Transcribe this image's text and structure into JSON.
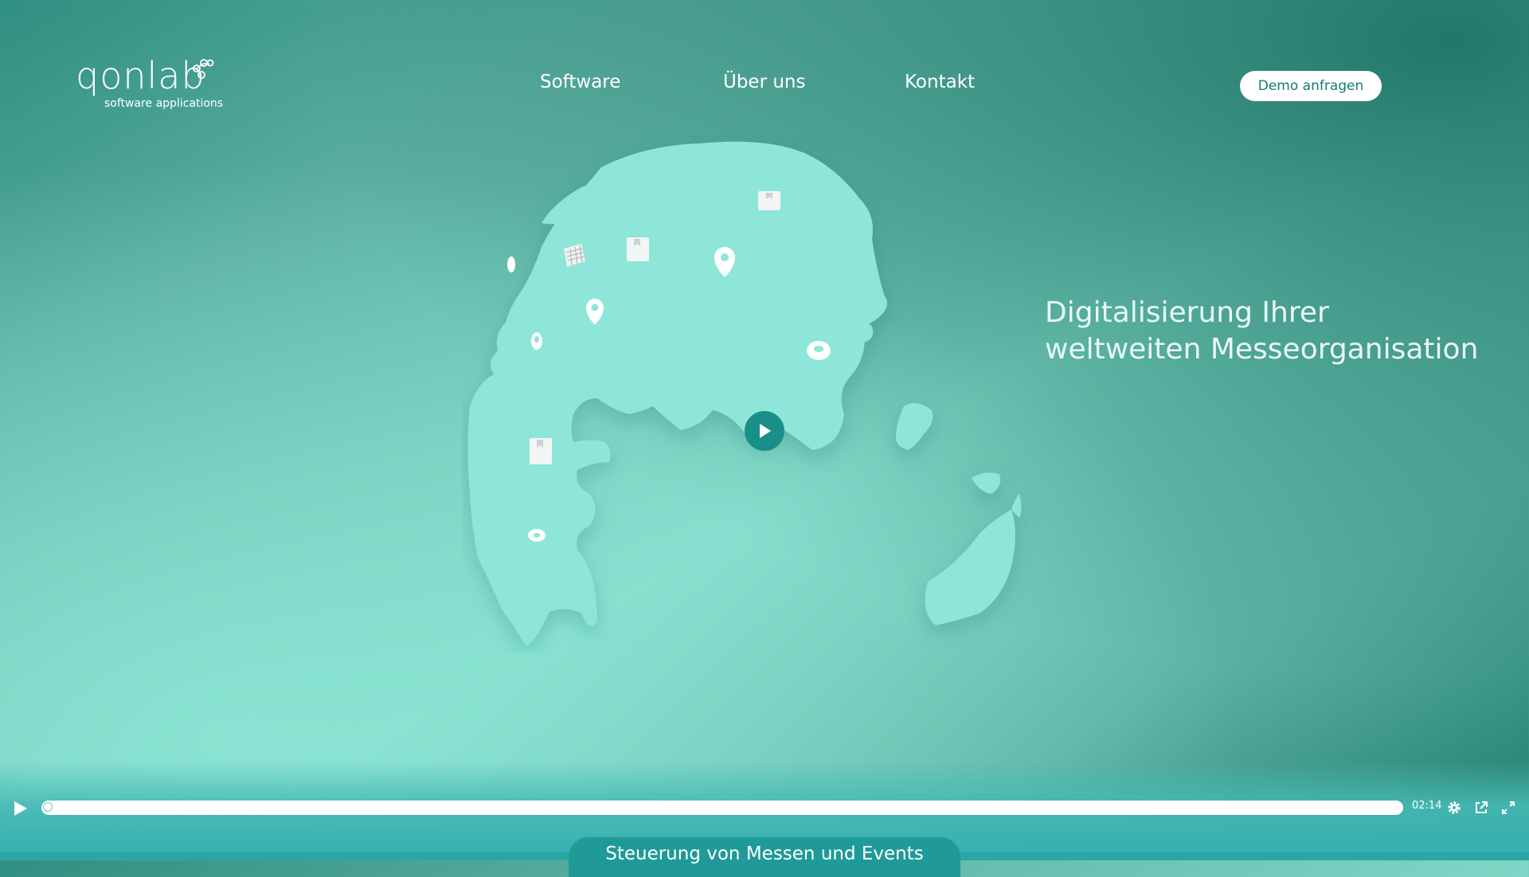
{
  "header": {
    "logo_text": "qonlab",
    "logo_subtitle": "software applications",
    "nav": [
      "Software",
      "Über uns",
      "Kontakt"
    ],
    "cta_label": "Demo anfragen"
  },
  "hero": {
    "headline_line1": "Digitalisierung Ihrer",
    "headline_line2": "weltweiten Messeorganisation"
  },
  "video": {
    "duration": "02:14",
    "progress": 0.0
  },
  "bottom_tab_label": "Steuerung von Messen und Events",
  "colors": {
    "accent": "#1a8f8a",
    "land": "#8ee6d8",
    "button_text": "#157d72"
  }
}
